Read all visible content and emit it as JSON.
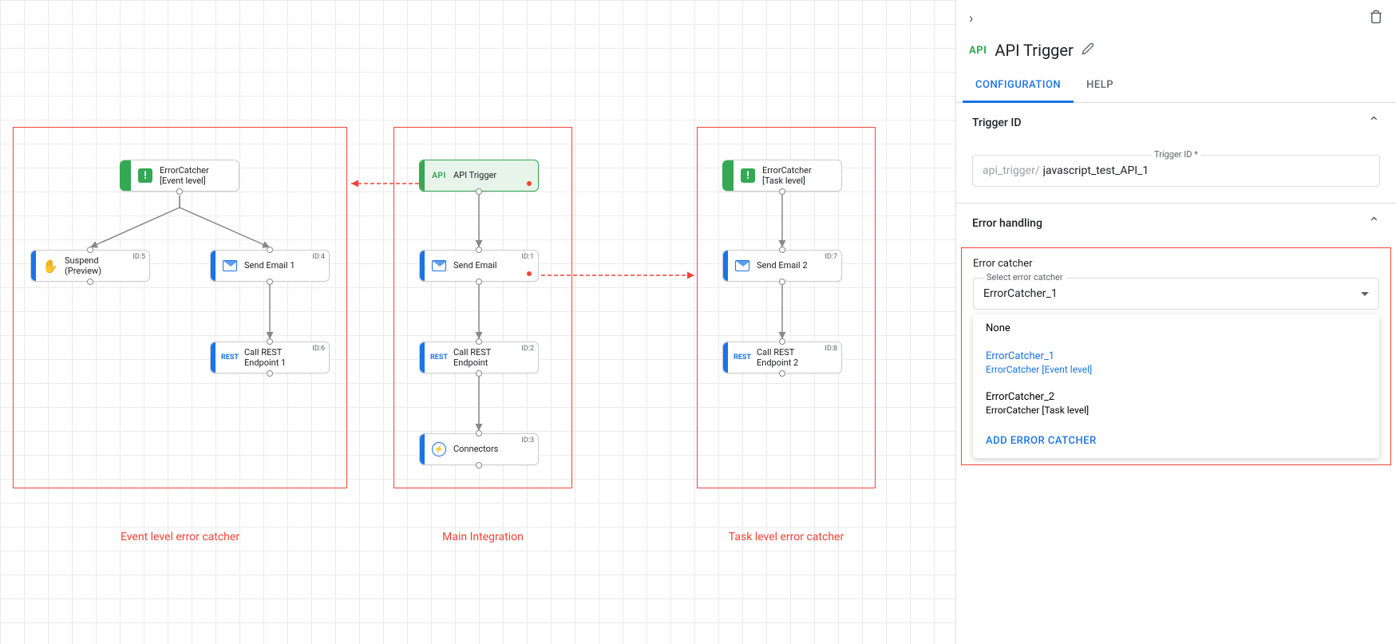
{
  "canvas": {
    "captions": {
      "eventLevel": "Event level error catcher",
      "main": "Main Integration",
      "taskLevel": "Task level error catcher"
    },
    "nodes": {
      "ec_event": {
        "label": "ErrorCatcher\n[Event level]"
      },
      "suspend": {
        "label": "Suspend\n(Preview)",
        "id": "ID:5"
      },
      "email1": {
        "label": "Send Email 1",
        "id": "ID:4"
      },
      "rest1": {
        "label": "Call REST\nEndpoint 1",
        "id": "ID:6"
      },
      "api_trigger": {
        "label": "API Trigger"
      },
      "email": {
        "label": "Send Email",
        "id": "ID:1"
      },
      "rest": {
        "label": "Call REST\nEndpoint",
        "id": "ID:2"
      },
      "connectors": {
        "label": "Connectors",
        "id": "ID:3"
      },
      "ec_task": {
        "label": "ErrorCatcher\n[Task level]"
      },
      "email2": {
        "label": "Send Email 2",
        "id": "ID:7"
      },
      "rest2": {
        "label": "Call REST\nEndpoint 2",
        "id": "ID:8"
      }
    }
  },
  "panel": {
    "title": "API Trigger",
    "tabs": {
      "config": "CONFIGURATION",
      "help": "HELP"
    },
    "triggerId": {
      "section": "Trigger ID",
      "label": "Trigger ID *",
      "prefix": "api_trigger/",
      "value": "javascript_test_API_1"
    },
    "errorHandling": {
      "section": "Error handling",
      "catcherTitle": "Error catcher",
      "selectLabel": "Select error catcher",
      "selectValue": "ErrorCatcher_1",
      "options": [
        {
          "title": "None",
          "sub": ""
        },
        {
          "title": "ErrorCatcher_1",
          "sub": "ErrorCatcher [Event level]",
          "selected": true
        },
        {
          "title": "ErrorCatcher_2",
          "sub": "ErrorCatcher [Task level]"
        }
      ],
      "addAction": "ADD ERROR CATCHER"
    }
  }
}
